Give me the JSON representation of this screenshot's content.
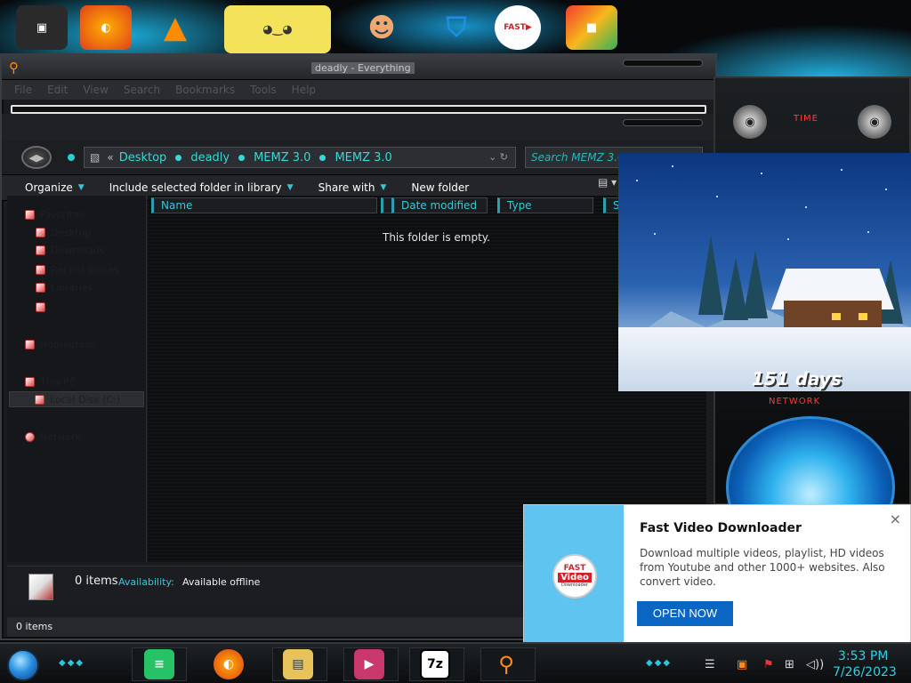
{
  "window": {
    "title": "deadly - Everything"
  },
  "menu": [
    "File",
    "Edit",
    "View",
    "Search",
    "Bookmarks",
    "Tools",
    "Help"
  ],
  "address": {
    "back_symbol": "«",
    "crumbs": [
      "Desktop",
      "deadly",
      "MEMZ 3.0",
      "MEMZ 3.0"
    ]
  },
  "search": {
    "placeholder": "Search MEMZ 3.0"
  },
  "toolbar": {
    "organize": "Organize",
    "include": "Include selected folder in library",
    "share": "Share with",
    "new_folder": "New folder"
  },
  "columns": [
    "Name",
    "Date modified",
    "Type",
    "Si"
  ],
  "content": {
    "empty_message": "This folder is empty."
  },
  "nav": {
    "items": [
      "Favorites",
      "Desktop",
      "Downloads",
      "Recent places",
      "Libraries",
      "Homegroup",
      "Computer",
      "This PC",
      "Local Disk (C:)",
      "Network"
    ]
  },
  "details": {
    "count": "0 items",
    "availability_label": "Availability:",
    "availability_value": "Available offline"
  },
  "status": {
    "count": "0 items"
  },
  "gadget": {
    "time_label": "TIME",
    "network_label": "NETWORK"
  },
  "countdown": {
    "days_text": "151 days"
  },
  "toast": {
    "title": "Fast Video Downloader",
    "body": "Download multiple videos, playlist, HD videos from Youtube and other 1000+ websites. Also convert video.",
    "button": "OPEN NOW",
    "close": "×",
    "logo_line1": "FAST",
    "logo_line2": "Video",
    "logo_line3": "Downloader"
  },
  "clock": {
    "time": "3:53 PM",
    "date": "7/26/2023"
  },
  "desktop_icons": [
    "app-icon",
    "firefox-icon",
    "vlc-icon",
    "spongebob-icon",
    "doctor-icon",
    "shield-icon",
    "fast-video-downloader-icon",
    "office-icon"
  ],
  "taskbar_apps": [
    "notes-icon",
    "firefox-icon",
    "explorer-icon",
    "media-icon",
    "7zip-icon",
    "everything-search-icon"
  ],
  "colors": {
    "accent_cyan": "#37d8d8",
    "toast_button": "#0b65c2",
    "toast_side": "#5fc5f0"
  }
}
